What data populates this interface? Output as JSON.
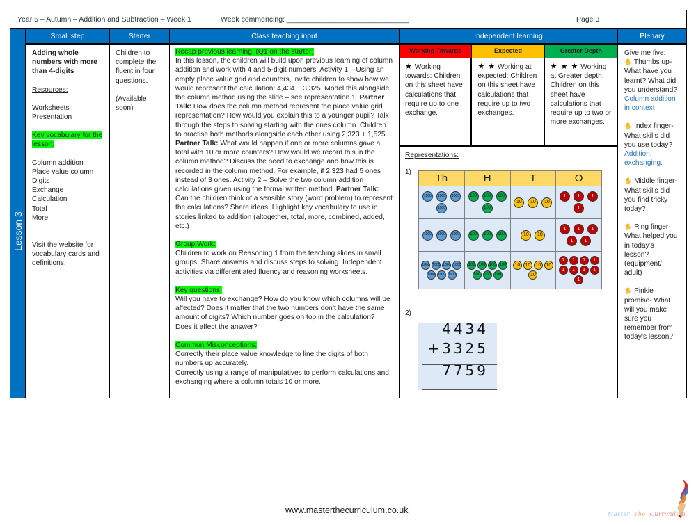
{
  "header": {
    "title": "Year 5 – Autumn – Addition and Subtraction – Week 1",
    "week_commencing": "Week commencing: ______________________________",
    "page": "Page 3"
  },
  "columns": [
    "Small step",
    "Starter",
    "Class teaching input",
    "Independent learning",
    "Plenary"
  ],
  "lesson_label": "Lesson 3",
  "small_step": {
    "title": "Adding whole numbers with more than 4-digits",
    "resources_label": "Resources:",
    "resources": [
      "Worksheets",
      "Presentation"
    ],
    "vocab_label": "Key vocabulary for the lesson:",
    "vocab": [
      "Column addition",
      "Place value column",
      "Digits",
      "Exchange",
      "Calculation",
      "Total",
      "More"
    ],
    "website_note": "Visit the website for vocabulary cards and definitions."
  },
  "starter": {
    "text": "Children to complete the fluent in four questions.",
    "note": "(Available soon)"
  },
  "teaching": {
    "recap_label": "Recap previous learning: (Q1 on the starter)",
    "p1_a": "In this lesson, the children will build upon previous learning of column addition and work with 4 and 5-digit numbers. Activity 1 – Using an empty place value grid and counters, invite children to show how we would represent the calculation: 4,434 + 3,325. Model this alongside the column method using the slide – see representation 1. ",
    "partner_talk": "Partner Talk:",
    "p1_b": " How does the column method represent the place value grid representation? How would you explain this to a younger pupil? Talk through the steps to solving starting with the ones column. Children to practise both methods alongside each other using 2,323 + 1,525. ",
    "p1_c": " What would happen if one or more columns gave a total with 10 or more counters? How would we record this in the column method? Discuss the need to exchange and how this is recorded in the column method. For example, if 2,323 had 5 ones instead of 3 ones. Activity 2 – Solve the two column addition calculations given using the formal written method. ",
    "p1_d": " Can the children think of a sensible story (word problem) to represent the calculations? Share ideas. Highlight key vocabulary to use in stories linked to addition (altogether, total,  more, combined, added, etc.)",
    "group_label": "Group Work:",
    "group_text": "Children to work on Reasoning 1 from the teaching slides in small groups. Share answers and discuss steps to solving. Independent activities via differentiated fluency and reasoning worksheets.",
    "keyq_label": "Key questions:",
    "keyq_text": "Will you have to exchange? How do you know which columns will be affected? Does it matter that the two numbers don’t have the same amount of digits? Which number goes on top in the calculation? Does it affect the answer?",
    "misc_label": "Common Misconceptions:",
    "misc_1": "Correctly their place value knowledge to line the digits of both numbers up accurately.",
    "misc_2": "Correctly using a range of manipulatives to perform calculations and exchanging where a column totals 10 or more."
  },
  "independent": {
    "levels": [
      {
        "label": "Working Towards",
        "color": "#ff0000",
        "stars": "★",
        "desc": "Working towards: Children on this sheet have calculations that require up to one exchange."
      },
      {
        "label": "Expected",
        "color": "#ffc000",
        "stars": "★ ★",
        "desc": "Working at expected: Children on this sheet have calculations that require up to two exchanges."
      },
      {
        "label": "Greater Depth",
        "color": "#00b050",
        "stars": "★ ★ ★",
        "desc": "Working at Greater depth: Children on this sheet have calculations that require up to two or more exchanges."
      }
    ],
    "reps_label": "Representations:",
    "rep1": "1)",
    "rep2": "2)",
    "pv_headers": [
      "Th",
      "H",
      "T",
      "O"
    ],
    "pv_rows": [
      {
        "th": 4,
        "h": 4,
        "t": 3,
        "o": 4
      },
      {
        "th": 3,
        "h": 3,
        "t": 2,
        "o": 5
      },
      {
        "th": 7,
        "h": 7,
        "t": 5,
        "o": 9
      }
    ],
    "counter_labels": {
      "th": "1000",
      "h": "100",
      "t": "10",
      "o": "1"
    },
    "column_method": {
      "top": "4434",
      "add": "+3325",
      "result": "7759"
    }
  },
  "plenary": {
    "intro": "Give me five:",
    "items": [
      {
        "text": "Thumbs up- What have you learnt? What did you understand?",
        "answer": "Column addition in context"
      },
      {
        "text": "Index finger- What skills did you use today?",
        "answer": "Addition, exchanging."
      },
      {
        "text": "Middle finger- What skills did you find tricky today?",
        "answer": ""
      },
      {
        "text": "Ring finger- What helped you in today’s lesson? (equipment/ adult)",
        "answer": ""
      },
      {
        "text": "Pinkie promise- What will you make sure you remember from today’s lesson?",
        "answer": ""
      }
    ],
    "hand_icon": "✋"
  },
  "footer": {
    "url": "www.masterthecurriculum.co.uk",
    "logo_text": "Master The Curriculum"
  }
}
